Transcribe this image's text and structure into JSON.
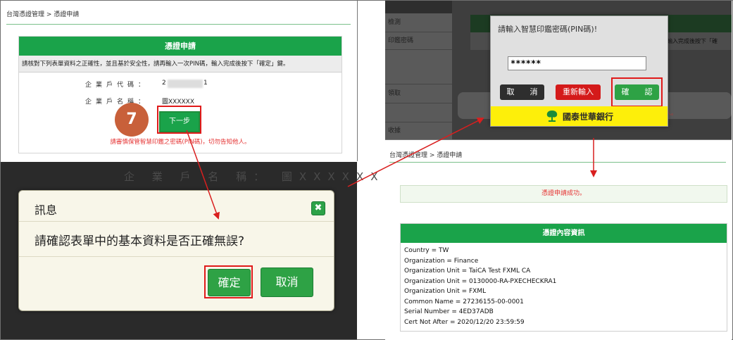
{
  "panel_a": {
    "breadcrumb": "台灣憑證管理 > 憑證申請",
    "header": "憑證申請",
    "instruction": "請核對下列表單資料之正確性，並且基於安全性，請再輸入一次PIN碼，輸入完成後按下「確定」鍵。",
    "field1_label": "企業戶代碼：",
    "field1_prefix": "2",
    "field1_suffix": "1",
    "field2_label": "企業戶名稱：",
    "field2_value": "圖XXXXXX",
    "next_button": "下一步",
    "step_number": "7",
    "warning": "請審慎保管智慧印鑑之密碼(PIN碼)，切勿告知他人。"
  },
  "panel_b": {
    "ghost_text": "企 業 戶 名 稱：  圖XXXXXX",
    "dialog_title": "訊息",
    "close_icon": "✖",
    "message": "請確認表單中的基本資料是否正確無誤?",
    "confirm_button": "確定",
    "cancel_button": "取消"
  },
  "panel_c": {
    "side_items": [
      "檢測",
      "印鑑密碼",
      "",
      "領取",
      "",
      "收據"
    ],
    "pin_title": "請輸入智慧印鑑密碼(PIN碼)!",
    "pin_value": "******",
    "cancel_button": "取　　消",
    "reenter_button": "重新輸入",
    "confirm_button": "確　　認",
    "bank_name": "國泰世華銀行",
    "bg_text_right": "，輸入完成後按下「確",
    "bg_text_red": "他人。"
  },
  "panel_d": {
    "breadcrumb": "台灣憑證管理 > 憑證申請",
    "success": "憑證申請成功。",
    "cert_header": "憑證內容資訊",
    "cert_lines": [
      "Country = TW",
      "Organization = Finance",
      "Organization Unit = TaiCA Test FXML CA",
      "Organization Unit = 0130000-RA-PXECHECKRA1",
      "Organization Unit = FXML",
      "Common Name = 27236155-00-0001",
      "Serial Number = 4ED37ADB",
      "Cert Not After = 2020/12/20 23:59:59"
    ]
  },
  "colors": {
    "green": "#1aa34a",
    "red": "#e01a1a",
    "step_orange": "#c8603a",
    "bank_yellow": "#fdef0a"
  }
}
